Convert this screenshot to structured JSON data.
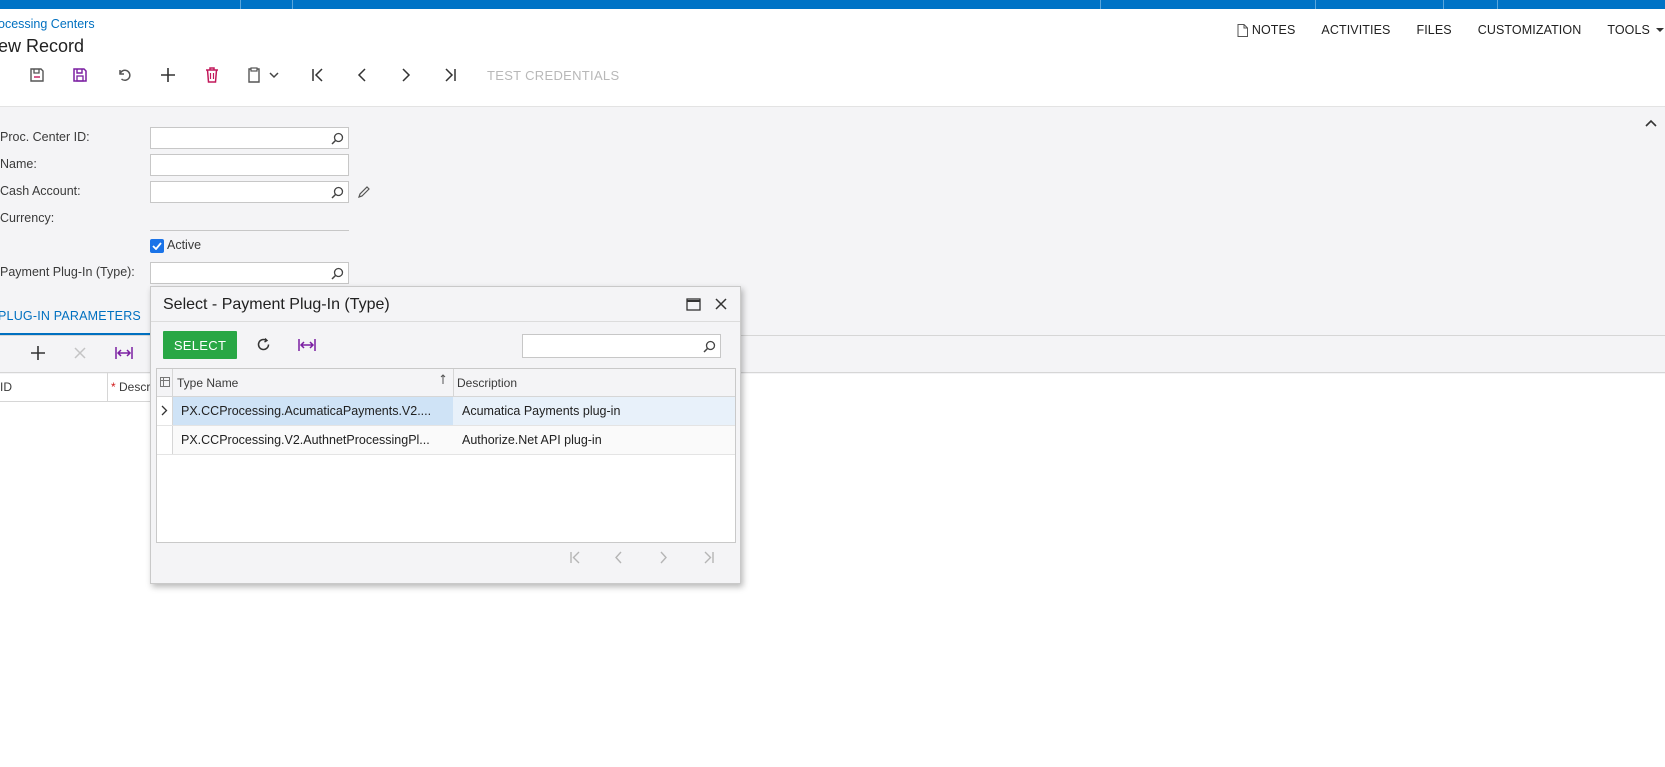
{
  "header": {
    "breadcrumb": "ocessing Centers",
    "title": "ew Record"
  },
  "top_menu": {
    "notes": "NOTES",
    "activities": "ACTIVITIES",
    "files": "FILES",
    "customization": "CUSTOMIZATION",
    "tools": "TOOLS"
  },
  "toolbar": {
    "test_credentials": "TEST CREDENTIALS"
  },
  "form": {
    "proc_center_id_label": "Proc. Center ID:",
    "proc_center_id_value": "",
    "name_label": "Name:",
    "name_value": "",
    "cash_account_label": "Cash Account:",
    "cash_account_value": "",
    "currency_label": "Currency:",
    "currency_value": "",
    "active_label": "Active",
    "active_checked": true,
    "plugin_type_label": "Payment Plug-In (Type):",
    "plugin_type_value": ""
  },
  "tabs": {
    "plugin_parameters": "PLUG-IN PARAMETERS"
  },
  "grid": {
    "col_id": "ID",
    "col_desc": "Descri"
  },
  "dialog": {
    "title": "Select - Payment Plug-In (Type)",
    "select_label": "SELECT",
    "search_placeholder": "",
    "columns": {
      "type_name": "Type Name",
      "description": "Description"
    },
    "rows": [
      {
        "type_name": "PX.CCProcessing.AcumaticaPayments.V2....",
        "description": "Acumatica Payments plug-in"
      },
      {
        "type_name": "PX.CCProcessing.V2.AuthnetProcessingPl...",
        "description": "Authorize.Net API plug-in"
      }
    ]
  },
  "colors": {
    "brand_blue": "#0073c6",
    "link_blue": "#0070c0",
    "select_green": "#28a745",
    "delete_red": "#c2185b"
  }
}
